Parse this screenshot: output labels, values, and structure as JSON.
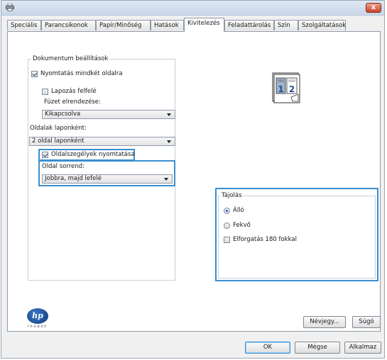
{
  "window": {
    "close_label": "x",
    "icons": {
      "title_icon": "printer-icon",
      "close_icon": "close-icon"
    }
  },
  "tabs": [
    {
      "label": "Speciális",
      "active": false
    },
    {
      "label": "Parancsikonok",
      "active": false
    },
    {
      "label": "Papír/Minőség",
      "active": false
    },
    {
      "label": "Hatások",
      "active": false
    },
    {
      "label": "Kivitelezés",
      "active": true
    },
    {
      "label": "Feladattárolás",
      "active": false
    },
    {
      "label": "Szín",
      "active": false
    },
    {
      "label": "Szolgáltatások",
      "active": false
    }
  ],
  "document_options": {
    "group_title": "Dokumentum beállítások",
    "print_both_sides": {
      "label": "Nyomtatás mindkét oldalra",
      "checked": true
    },
    "flip_pages_up": {
      "label": "Lapozás felfelé",
      "checked": false
    },
    "booklet_layout_label": "Füzet elrendezése:",
    "booklet_layout_value": "Kikapcsolva",
    "pages_per_sheet_label": "Oldalak laponként:",
    "pages_per_sheet_value": "2 oldal laponként",
    "print_page_borders": {
      "label": "Oldalszegélyek nyomtatása",
      "checked": true
    },
    "page_order_label": "Oldal sorrend:",
    "page_order_value": "Jobbra, majd lefelé"
  },
  "preview": {
    "page_numbers": [
      "1",
      "2"
    ]
  },
  "orientation": {
    "group_title": "Tájolás",
    "portrait": {
      "label": "Álló",
      "selected": true
    },
    "landscape": {
      "label": "Fekvő",
      "selected": false
    },
    "rotate_180": {
      "label": "Elforgatás 180 fokkal",
      "checked": false
    }
  },
  "logo": {
    "brand": "hp",
    "tagline": "invent"
  },
  "buttons": {
    "about": "Névjegy...",
    "help": "Súgó",
    "ok": "OK",
    "cancel": "Mégse",
    "apply": "Alkalmaz"
  },
  "colors": {
    "highlight": "#3a8fd0",
    "radio_selected": "#1e63c4",
    "close_button": "#c9452b"
  }
}
